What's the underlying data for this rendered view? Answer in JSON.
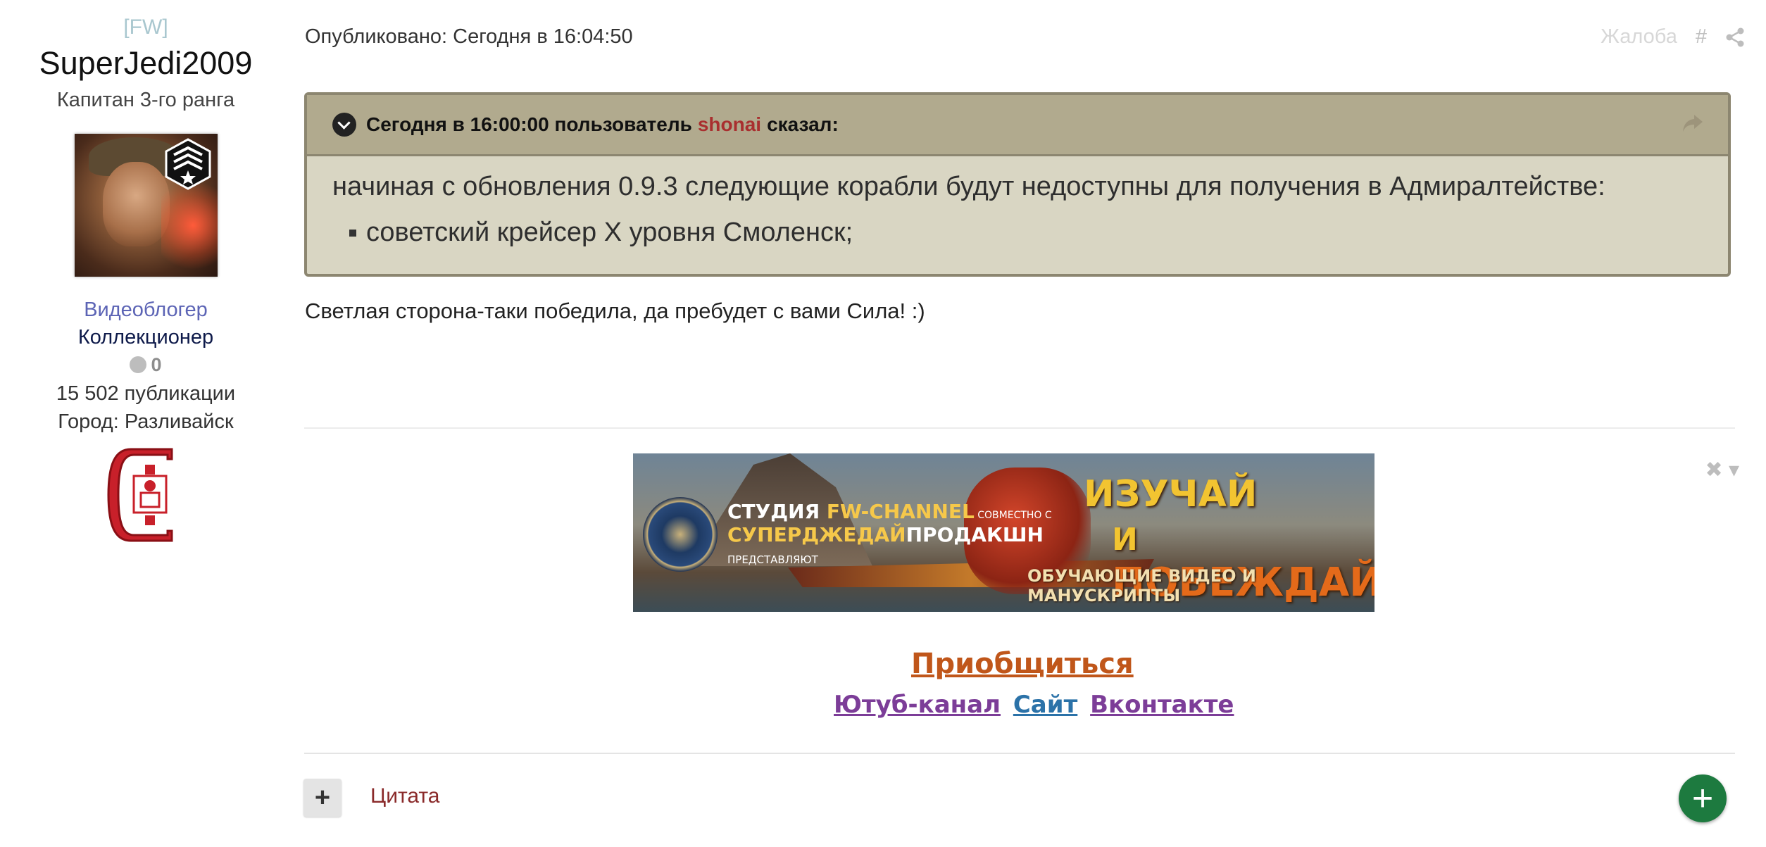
{
  "author": {
    "clan_tag": "[FW]",
    "username": "SuperJedi2009",
    "rank": "Капитан 3-го ранга",
    "group_primary": "Видеоблогер",
    "group_secondary": "Коллекционер",
    "reputation": "0",
    "posts_count": "15 502 публикации",
    "city": "Город: Разливайск"
  },
  "post": {
    "published": "Опубликовано: Сегодня в 16:04:50",
    "report_label": "Жалоба",
    "hash_label": "#",
    "text": "Светлая сторона-таки победила, да пребудет с вами Сила! :)"
  },
  "quote": {
    "prefix": "Сегодня в 16:00:00 пользователь",
    "user": "shonai",
    "suffix": "сказал:",
    "line1": "начиная с обновления 0.9.3 следующие корабли будут недоступны для получения в Адмиралтействе:",
    "list_item": "советский крейсер X уровня Смоленск;"
  },
  "banner": {
    "studio_line1_a": "СТУДИЯ ",
    "studio_line1_b": "FW-CHANNEL",
    "studio_line1_c": " СОВМЕСТНО С",
    "studio_line2_a": "СУПЕРДЖЕДАЙ",
    "studio_line2_b": "ПРОДАКШН",
    "studio_line3": "ПРЕДСТАВЛЯЮТ",
    "title1": "ИЗУЧАЙ",
    "title2_small": "И ",
    "title2": "ПОБЕЖДАЙ!",
    "subtitle": "ОБУЧАЮЩИЕ ВИДЕО И МАНУСКРИПТЫ"
  },
  "signature": {
    "join_label": "Приобщиться",
    "youtube_label": "Ютуб-канал",
    "site_label": "Сайт",
    "vk_label": "Вконтакте"
  },
  "actions": {
    "quote_label": "Цитата",
    "plus_label": "+",
    "fab_label": "+"
  },
  "colors": {
    "quote_header_bg": "#b1aa8e",
    "quote_body_bg": "#d9d6c3",
    "quote_user": "#a92f2f",
    "join_link": "#c0561a",
    "fab_bg": "#1d7a3f"
  },
  "icons": [
    "chevron-down-icon",
    "reply-icon",
    "share-icon",
    "close-icon",
    "rank-badge-icon",
    "plus-icon"
  ]
}
